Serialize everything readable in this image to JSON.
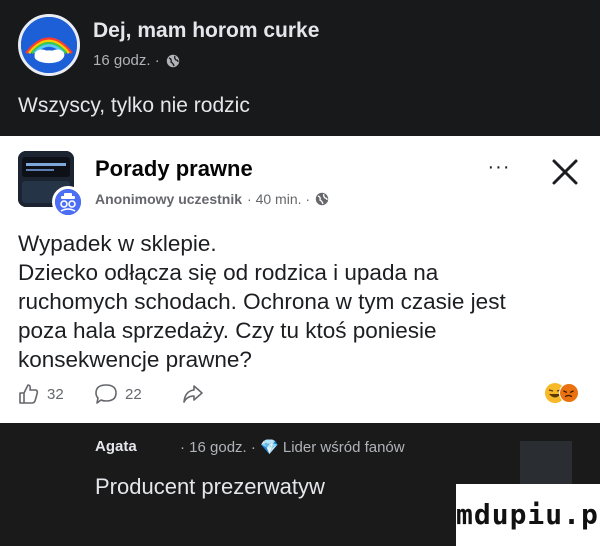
{
  "shared_post": {
    "title": "Dej, mam horom curke",
    "time": "16 godz. · ",
    "text": "Wszyscy, tylko nie rodzic"
  },
  "card": {
    "group_name": "Porady prawne",
    "author": "Anonimowy uczestnik",
    "time": " · 40 min. · ",
    "body_lines": [
      "Wypadek w sklepie.",
      "Dziecko odłącza się od rodzica i upada na",
      "ruchomych schodach. Ochrona w tym czasie jest",
      "poza hala sprzedaży. Czy tu ktoś poniesie",
      "konsekwencje prawne?"
    ],
    "like_count": "32",
    "comment_count": "22",
    "more_label": "···"
  },
  "comment": {
    "author": "Agata",
    "meta": "· 16 godz. · 💎 Lider wśród fanów",
    "text": "Producent prezerwatyw"
  },
  "watermark": "mdupiu.pl",
  "colors": {
    "dark_bg": "#18191a",
    "card_bg": "#ffffff",
    "accent_blue": "#1c5fd6",
    "muted": "#65676b"
  },
  "icons": [
    "globe-icon",
    "more-icon",
    "close-icon",
    "like-icon",
    "comment-icon",
    "share-icon",
    "laugh-emoji-icon",
    "angry-emoji-icon"
  ]
}
